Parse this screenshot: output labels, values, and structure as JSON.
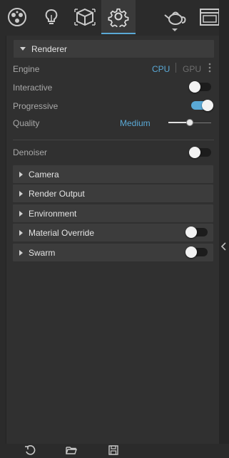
{
  "toolbar": {
    "tabs": [
      {
        "icon": "materials-icon"
      },
      {
        "icon": "lighting-icon"
      },
      {
        "icon": "object-icon"
      },
      {
        "icon": "settings-icon",
        "active": true
      },
      {
        "icon": "teapot-icon"
      },
      {
        "icon": "window-icon"
      }
    ]
  },
  "renderer": {
    "title": "Renderer",
    "engine_label": "Engine",
    "engine_cpu": "CPU",
    "engine_gpu": "GPU",
    "interactive_label": "Interactive",
    "progressive_label": "Progressive",
    "quality_label": "Quality",
    "quality_value": "Medium",
    "quality_level": 0.5,
    "interactive_on": false,
    "progressive_on": true
  },
  "denoiser": {
    "label": "Denoiser",
    "on": false
  },
  "sections": [
    {
      "title": "Camera"
    },
    {
      "title": "Render Output"
    },
    {
      "title": "Environment"
    },
    {
      "title": "Material Override",
      "has_toggle": true,
      "on": false
    },
    {
      "title": "Swarm",
      "has_toggle": true,
      "on": false
    }
  ],
  "bottom": {
    "icons": [
      "undo-icon",
      "folder-open-icon",
      "save-icon"
    ]
  },
  "colors": {
    "accent": "#5aa9d6",
    "background": "#2b2b2b",
    "panel": "#303030",
    "header": "#3c3c3c"
  }
}
